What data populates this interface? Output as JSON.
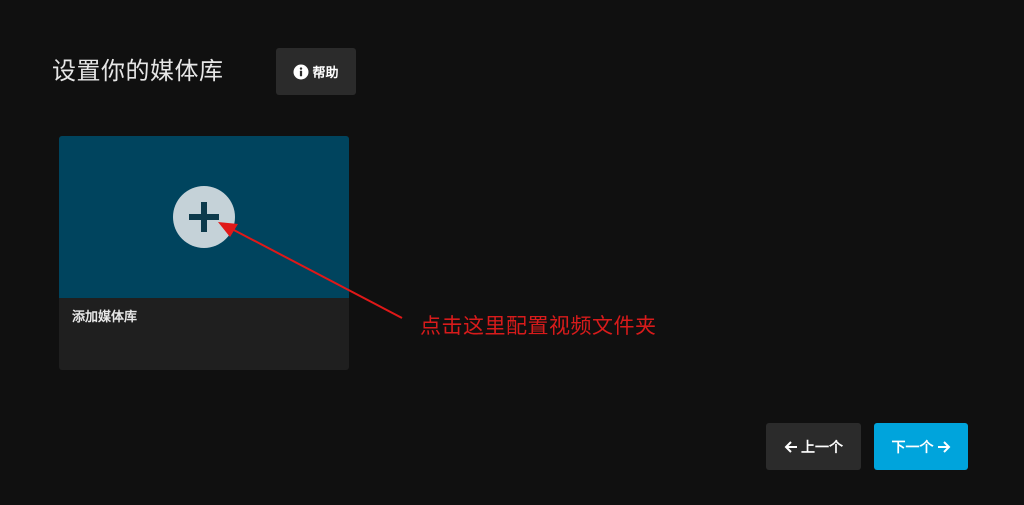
{
  "header": {
    "title": "设置你的媒体库",
    "help_label": "帮助"
  },
  "library_card": {
    "label": "添加媒体库"
  },
  "annotation": {
    "text": "点击这里配置视频文件夹"
  },
  "navigation": {
    "prev_label": "上一个",
    "next_label": "下一个"
  },
  "icons": {
    "help": "info-icon",
    "add": "plus-icon",
    "prev": "arrow-left-icon",
    "next": "arrow-right-icon"
  },
  "colors": {
    "background": "#101010",
    "card_image": "#00445e",
    "card_body": "#1f1f1f",
    "accent": "#00a4dc",
    "annotation": "#d81b1b",
    "button_dark": "#2b2b2b"
  }
}
